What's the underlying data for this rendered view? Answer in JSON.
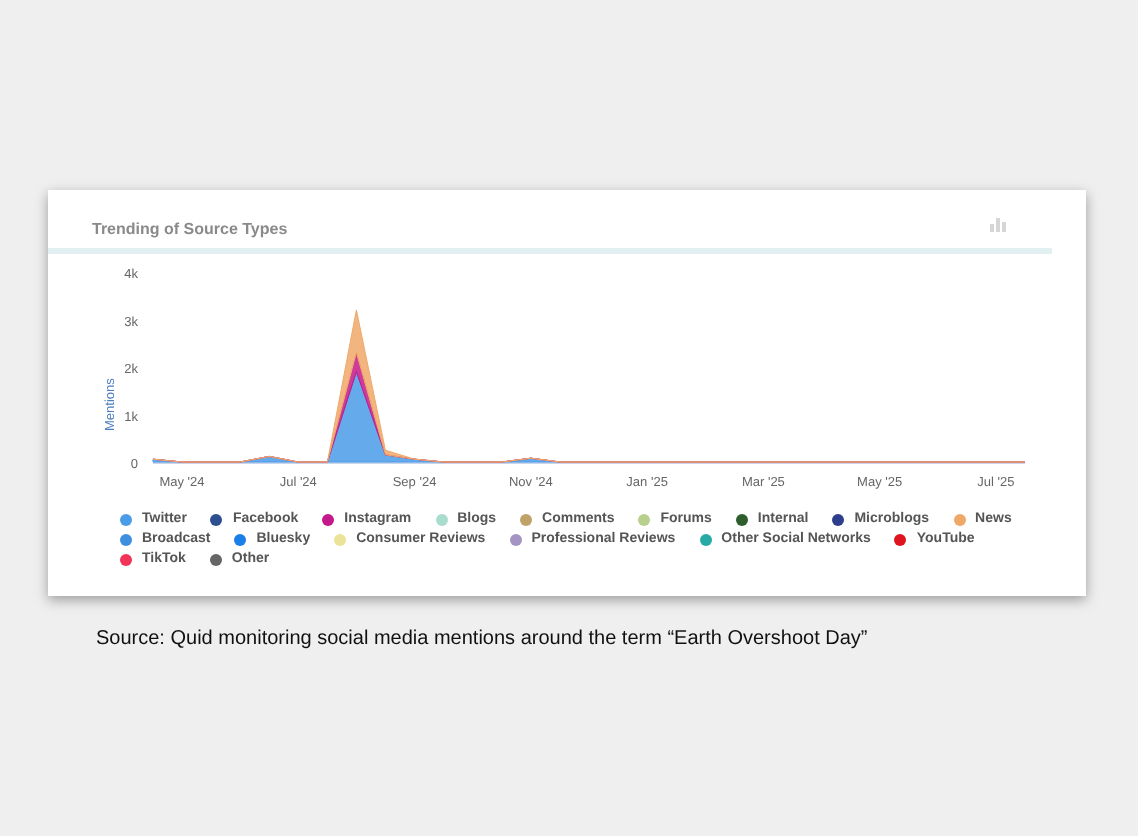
{
  "card": {
    "title": "Trending of Source Types",
    "chart_data": {
      "type": "area",
      "stacked": true,
      "ylabel": "Mentions",
      "ylim": [
        0,
        4000
      ],
      "categories": [
        null,
        "May '24",
        null,
        null,
        null,
        "Jul '24",
        null,
        null,
        null,
        "Sep '24",
        null,
        null,
        null,
        "Nov '24",
        null,
        null,
        null,
        "Jan '25",
        null,
        null,
        null,
        "Mar '25",
        null,
        null,
        null,
        "May '25",
        null,
        null,
        null,
        "Jul '25",
        null
      ],
      "yticks": [
        {
          "value": 0,
          "label": "0"
        },
        {
          "value": 1000,
          "label": "1k"
        },
        {
          "value": 2000,
          "label": "2k"
        },
        {
          "value": 3000,
          "label": "3k"
        },
        {
          "value": 4000,
          "label": "4k"
        }
      ],
      "series": [
        {
          "name": "Twitter",
          "color": "#4a9be8",
          "values": [
            60,
            0,
            0,
            0,
            120,
            0,
            0,
            1900,
            150,
            60,
            0,
            0,
            0,
            80,
            0,
            0,
            0,
            0,
            0,
            0,
            0,
            0,
            0,
            0,
            0,
            0,
            0,
            0,
            0,
            0,
            0
          ]
        },
        {
          "name": "Facebook",
          "color": "#2c4f8f",
          "values": [
            null,
            null,
            null,
            null,
            null,
            null,
            null,
            null,
            null,
            null,
            null,
            null,
            null,
            null,
            null,
            null,
            null,
            null,
            null,
            null,
            null,
            null,
            null,
            null,
            null,
            null,
            null,
            null,
            null,
            null,
            null
          ]
        },
        {
          "name": "Instagram",
          "color": "#c4198a",
          "values": [
            0,
            0,
            0,
            0,
            0,
            0,
            0,
            400,
            0,
            0,
            0,
            0,
            0,
            0,
            0,
            0,
            0,
            0,
            0,
            0,
            0,
            0,
            0,
            0,
            0,
            0,
            0,
            0,
            0,
            0,
            0
          ]
        },
        {
          "name": "Blogs",
          "color": "#a9dccd",
          "values": [
            null,
            null,
            null,
            null,
            null,
            null,
            null,
            null,
            null,
            null,
            null,
            null,
            null,
            null,
            null,
            null,
            null,
            null,
            null,
            null,
            null,
            null,
            null,
            null,
            null,
            null,
            null,
            null,
            null,
            null,
            null
          ]
        },
        {
          "name": "Comments",
          "color": "#bfa268",
          "values": [
            null,
            null,
            null,
            null,
            null,
            null,
            null,
            null,
            null,
            null,
            null,
            null,
            null,
            null,
            null,
            null,
            null,
            null,
            null,
            null,
            null,
            null,
            null,
            null,
            null,
            null,
            null,
            null,
            null,
            null,
            null
          ]
        },
        {
          "name": "Forums",
          "color": "#b7d08e",
          "values": [
            null,
            null,
            null,
            null,
            null,
            null,
            null,
            null,
            null,
            null,
            null,
            null,
            null,
            null,
            null,
            null,
            null,
            null,
            null,
            null,
            null,
            null,
            null,
            null,
            null,
            null,
            null,
            null,
            null,
            null,
            null
          ]
        },
        {
          "name": "Internal",
          "color": "#2e5e2c",
          "values": [
            null,
            null,
            null,
            null,
            null,
            null,
            null,
            null,
            null,
            null,
            null,
            null,
            null,
            null,
            null,
            null,
            null,
            null,
            null,
            null,
            null,
            null,
            null,
            null,
            null,
            null,
            null,
            null,
            null,
            null,
            null
          ]
        },
        {
          "name": "Microblogs",
          "color": "#2d3e8c",
          "values": [
            null,
            null,
            null,
            null,
            null,
            null,
            null,
            null,
            null,
            null,
            null,
            null,
            null,
            null,
            null,
            null,
            null,
            null,
            null,
            null,
            null,
            null,
            null,
            null,
            null,
            null,
            null,
            null,
            null,
            null,
            null
          ]
        },
        {
          "name": "News",
          "color": "#f0a86a",
          "values": [
            0,
            0,
            0,
            0,
            0,
            0,
            0,
            900,
            100,
            0,
            0,
            0,
            0,
            0,
            0,
            0,
            0,
            0,
            0,
            0,
            0,
            0,
            0,
            0,
            0,
            0,
            0,
            0,
            0,
            0,
            0
          ]
        },
        {
          "name": "Broadcast",
          "color": "#3f8fe0",
          "values": [
            null,
            null,
            null,
            null,
            null,
            null,
            null,
            null,
            null,
            null,
            null,
            null,
            null,
            null,
            null,
            null,
            null,
            null,
            null,
            null,
            null,
            null,
            null,
            null,
            null,
            null,
            null,
            null,
            null,
            null,
            null
          ]
        },
        {
          "name": "Bluesky",
          "color": "#1a7fe8",
          "values": [
            null,
            null,
            null,
            null,
            null,
            null,
            null,
            null,
            null,
            null,
            null,
            null,
            null,
            null,
            null,
            null,
            null,
            null,
            null,
            null,
            null,
            null,
            null,
            null,
            null,
            null,
            null,
            null,
            null,
            null,
            null
          ]
        },
        {
          "name": "Consumer Reviews",
          "color": "#ece39a",
          "values": [
            null,
            null,
            null,
            null,
            null,
            null,
            null,
            null,
            null,
            null,
            null,
            null,
            null,
            null,
            null,
            null,
            null,
            null,
            null,
            null,
            null,
            null,
            null,
            null,
            null,
            null,
            null,
            null,
            null,
            null,
            null
          ]
        },
        {
          "name": "Professional Reviews",
          "color": "#a494c4",
          "values": [
            null,
            null,
            null,
            null,
            null,
            null,
            null,
            null,
            null,
            null,
            null,
            null,
            null,
            null,
            null,
            null,
            null,
            null,
            null,
            null,
            null,
            null,
            null,
            null,
            null,
            null,
            null,
            null,
            null,
            null,
            null
          ]
        },
        {
          "name": "Other Social Networks",
          "color": "#26aaa6",
          "values": [
            null,
            null,
            null,
            null,
            null,
            null,
            null,
            null,
            null,
            null,
            null,
            null,
            null,
            null,
            null,
            null,
            null,
            null,
            null,
            null,
            null,
            null,
            null,
            null,
            null,
            null,
            null,
            null,
            null,
            null,
            null
          ]
        },
        {
          "name": "YouTube",
          "color": "#e0141e",
          "values": [
            null,
            null,
            null,
            null,
            null,
            null,
            null,
            null,
            null,
            null,
            null,
            null,
            null,
            null,
            null,
            null,
            null,
            null,
            null,
            null,
            null,
            null,
            null,
            null,
            null,
            null,
            null,
            null,
            null,
            null,
            null
          ]
        },
        {
          "name": "TikTok",
          "color": "#f0345a",
          "values": [
            null,
            null,
            null,
            null,
            null,
            null,
            null,
            null,
            null,
            null,
            null,
            null,
            null,
            null,
            null,
            null,
            null,
            null,
            null,
            null,
            null,
            null,
            null,
            null,
            null,
            null,
            null,
            null,
            null,
            null,
            null
          ]
        },
        {
          "name": "Other",
          "color": "#666666",
          "values": [
            null,
            null,
            null,
            null,
            null,
            null,
            null,
            null,
            null,
            null,
            null,
            null,
            null,
            null,
            null,
            null,
            null,
            null,
            null,
            null,
            null,
            null,
            null,
            null,
            null,
            null,
            null,
            null,
            null,
            null,
            null
          ]
        }
      ]
    }
  },
  "caption": "Source: Quid monitoring social media mentions around the term “Earth Overshoot Day”"
}
